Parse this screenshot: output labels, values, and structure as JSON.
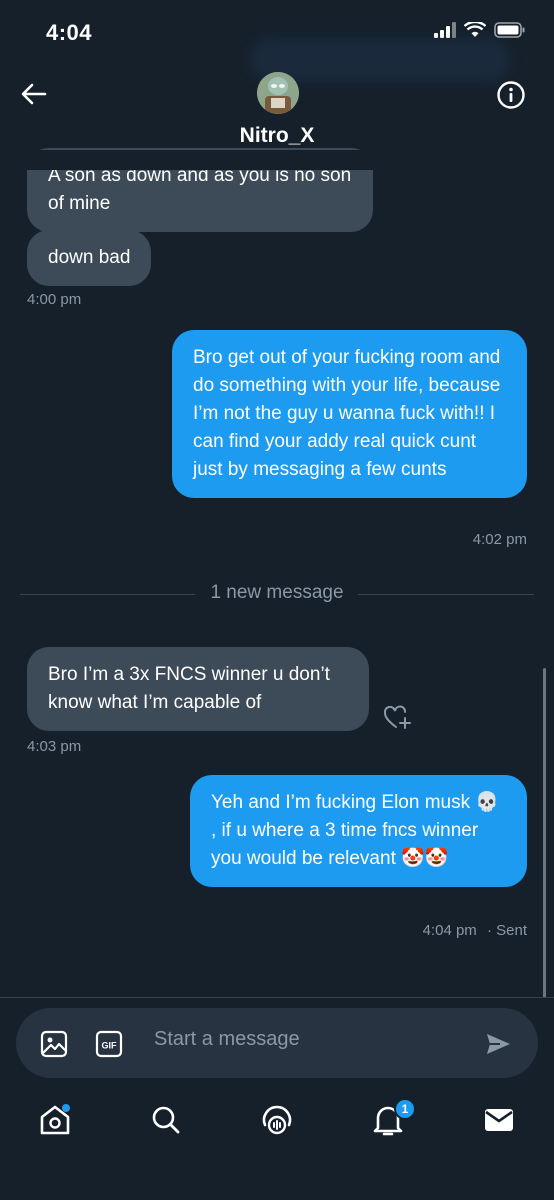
{
  "status_bar": {
    "time": "4:04"
  },
  "header": {
    "username": "Nitro_X"
  },
  "messages": [
    {
      "direction": "in",
      "text": "A son as down and as you is no son of mine"
    },
    {
      "direction": "in",
      "text": "down bad",
      "time": "4:00 pm"
    },
    {
      "direction": "out",
      "text": "Bro get out of your fucking room and do something with your life, because I’m not the guy u wanna fuck with!! I can find your addy real quick cunt just by messaging a few cunts",
      "time": "4:02 pm"
    },
    {
      "direction": "in",
      "text": "Bro I’m a 3x FNCS winner u don’t know what I’m capable of",
      "time": "4:03 pm"
    },
    {
      "direction": "out",
      "text": "Yeh and I’m fucking Elon musk 💀 , if u where a 3 time fncs winner you would be relevant 🤡🤡",
      "time": "4:04 pm",
      "status": "· Sent"
    }
  ],
  "divider": {
    "label": "1 new message"
  },
  "composer": {
    "placeholder": "Start a message",
    "gif_label": "GIF"
  },
  "nav": {
    "notifications_count": "1"
  },
  "colors": {
    "background": "#15202b",
    "incoming_bubble": "#3d4a57",
    "outgoing_bubble": "#1d9bf0",
    "muted_text": "#8b98a5"
  },
  "icons": [
    "back-arrow-icon",
    "info-icon",
    "image-icon",
    "gif-icon",
    "send-icon",
    "home-icon",
    "search-icon",
    "spaces-icon",
    "bell-icon",
    "mail-icon",
    "heart-plus-icon"
  ]
}
